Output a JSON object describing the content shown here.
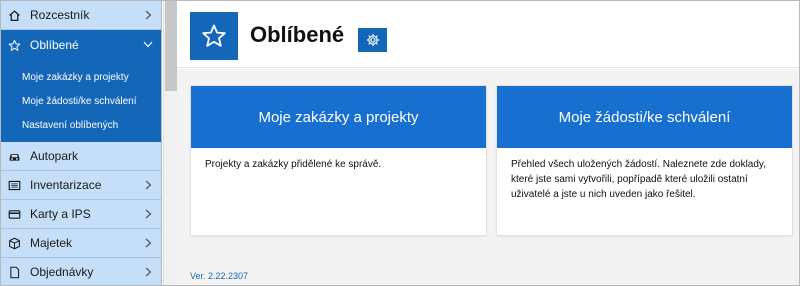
{
  "sidebar": {
    "items": [
      {
        "label": "Rozcestník",
        "icon": "home-icon",
        "has_chevron": true
      },
      {
        "label": "Oblíbené",
        "icon": "star-icon",
        "expanded": true
      },
      {
        "label": "Autopark",
        "icon": "car-icon",
        "has_chevron": false
      },
      {
        "label": "Inventarizace",
        "icon": "inventory-icon",
        "has_chevron": true
      },
      {
        "label": "Karty a IPS",
        "icon": "card-icon",
        "has_chevron": true
      },
      {
        "label": "Majetek",
        "icon": "box-icon",
        "has_chevron": true
      },
      {
        "label": "Objednávky",
        "icon": "document-icon",
        "has_chevron": true
      }
    ],
    "submenu": [
      {
        "label": "Moje zakázky a projekty"
      },
      {
        "label": "Moje žádosti/ke schválení"
      },
      {
        "label": "Nastavení oblíbených"
      }
    ]
  },
  "header": {
    "title": "Oblíbené",
    "badge_icon": "star-icon",
    "settings_icon": "gear-icon"
  },
  "cards": [
    {
      "title": "Moje zakázky a projekty",
      "description": "Projekty a zakázky přidělené ke správě."
    },
    {
      "title": "Moje žádosti/ke schválení",
      "description": "Přehled všech uložených žádostí. Naleznete zde doklady, které jste sami vytvořili, popřípadě které uložili ostatní uživatelé a jste u nich uveden jako řešitel."
    }
  ],
  "footer": {
    "version": "Ver. 2.22.2307"
  },
  "colors": {
    "primary": "#1466b8",
    "card_header": "#1770cf",
    "sidebar_bg": "#c4dff7",
    "content_bg": "#f3f3f3"
  }
}
